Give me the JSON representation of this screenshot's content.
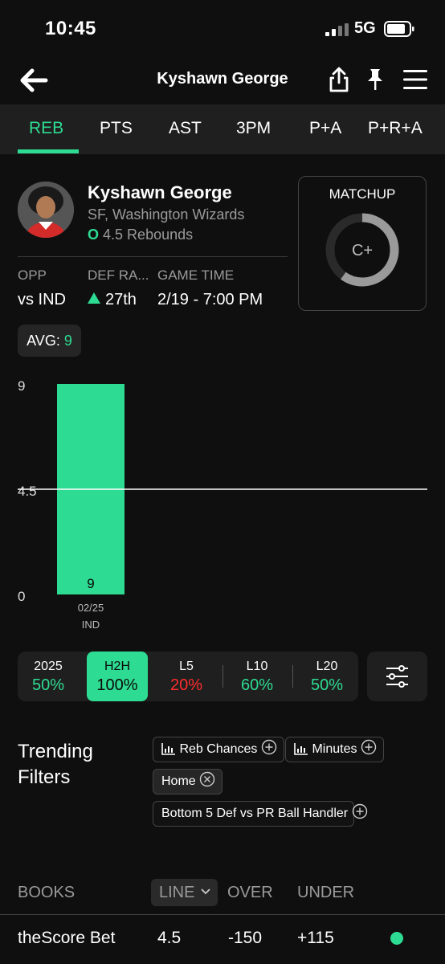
{
  "status": {
    "time": "10:45",
    "network": "5G"
  },
  "nav": {
    "title": "Kyshawn George"
  },
  "tabs": [
    "REB",
    "PTS",
    "AST",
    "3PM",
    "P+A",
    "P+R+A"
  ],
  "player": {
    "name": "Kyshawn George",
    "team": "SF, Washington Wizards",
    "line_prefix": "O",
    "line": "4.5 Rebounds"
  },
  "stats": {
    "opp_label": "OPP",
    "opp_value": "vs IND",
    "def_label": "DEF RA...",
    "def_value": "27th",
    "time_label": "GAME TIME",
    "time_value": "2/19 - 7:00 PM"
  },
  "matchup": {
    "title": "MATCHUP",
    "grade": "C+",
    "fill": 0.6
  },
  "avg": {
    "label": "AVG:",
    "value": "9"
  },
  "chart_data": {
    "type": "bar",
    "categories": [
      "02/25\nIND"
    ],
    "category_date": "02/25",
    "category_opp": "IND",
    "values": [
      9
    ],
    "value_labels": [
      "9"
    ],
    "y_ticks": [
      "9",
      "4.5",
      "0"
    ],
    "ylim": [
      0,
      9
    ],
    "reference_line": 4.5,
    "bar_color": "#2edb92"
  },
  "filters": [
    {
      "label": "2025",
      "pct": "50%",
      "color": "#2edb92"
    },
    {
      "label": "H2H",
      "pct": "100%",
      "color": "#0a0a0a",
      "active": true
    },
    {
      "label": "L5",
      "pct": "20%",
      "color": "#ff2d2d"
    },
    {
      "label": "L10",
      "pct": "60%",
      "color": "#2edb92"
    },
    {
      "label": "L20",
      "pct": "50%",
      "color": "#2edb92"
    }
  ],
  "trending": {
    "title_line1": "Trending",
    "title_line2": "Filters",
    "chips": {
      "reb_chances": "Reb Chances",
      "minutes": "Minutes",
      "home": "Home",
      "bottom5": "Bottom 5 Def vs PR Ball Handler"
    }
  },
  "books": {
    "headers": {
      "books": "BOOKS",
      "line": "LINE",
      "over": "OVER",
      "under": "UNDER"
    },
    "rows": [
      {
        "book": "theScore Bet",
        "line": "4.5",
        "over": "-150",
        "under": "+115"
      }
    ]
  },
  "colors": {
    "accent": "#2edb92",
    "negative": "#ff2d2d",
    "bg": "#0f0f0f"
  }
}
